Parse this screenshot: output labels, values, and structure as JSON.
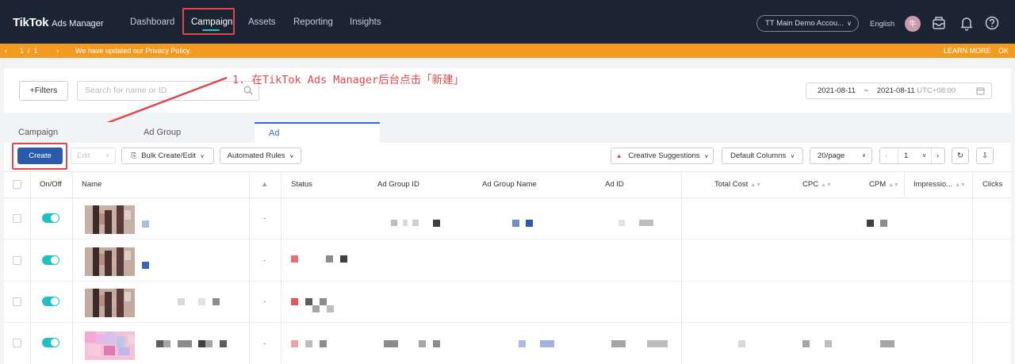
{
  "brand": {
    "logo": "TikTok",
    "product": "Ads Manager"
  },
  "nav": [
    {
      "label": "Dashboard",
      "active": false
    },
    {
      "label": "Campaign",
      "active": true
    },
    {
      "label": "Assets",
      "active": false
    },
    {
      "label": "Reporting",
      "active": false
    },
    {
      "label": "Insights",
      "active": false
    }
  ],
  "account": {
    "label": "TT Main Demo Accou...",
    "icon": "chevron-down-icon"
  },
  "language": "English",
  "avatar_initial": "牛",
  "top_icons": [
    "inbox-icon",
    "bell-icon",
    "help-icon"
  ],
  "notice": {
    "pager": "1  /  1",
    "message": "We have updated our Privacy Policy.",
    "learn_more": "LEARN MORE",
    "ok": "OK"
  },
  "annotation": "1. 在TikTok Ads Manager后台点击「新建」",
  "filters": {
    "button": "+Filters",
    "search_placeholder": "Search for name or ID"
  },
  "date_range": {
    "start": "2021-08-11",
    "sep": "~",
    "end": "2021-08-11",
    "tz": "UTC+08:00"
  },
  "tabs": [
    {
      "label": "Campaign",
      "active": false
    },
    {
      "label": "Ad Group",
      "active": false
    },
    {
      "label": "Ad",
      "active": true
    }
  ],
  "toolbar": {
    "create": "Create",
    "edit": "Edit",
    "bulk": "Bulk Create/Edit",
    "rules": "Automated Rules",
    "suggestions": "Creative Suggestions",
    "columns": "Default Columns",
    "per_page": "20/page",
    "page": "1"
  },
  "columns": [
    "On/Off",
    "Name",
    "Status",
    "Ad Group ID",
    "Ad Group Name",
    "Ad ID",
    "Total Cost",
    "CPC",
    "CPM",
    "Impressio...",
    "Clicks"
  ],
  "rows": [
    {
      "on": true,
      "dash": "-"
    },
    {
      "on": true,
      "dash": "-"
    },
    {
      "on": true,
      "dash": "-"
    },
    {
      "on": true,
      "dash": "-"
    }
  ],
  "colors": {
    "nav_bg": "#1b2433",
    "notice": "#f29b20",
    "primary": "#2b5aa8",
    "toggle": "#1fc2c2",
    "annotation": "#e0474c"
  }
}
